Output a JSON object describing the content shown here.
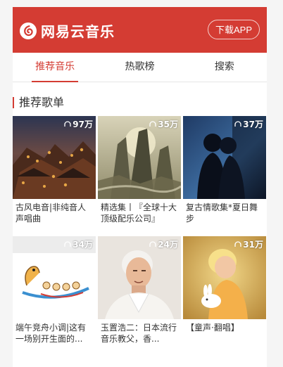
{
  "header": {
    "logo_text": "网易云音乐",
    "download_label": "下载APP",
    "brand_color": "#d43c33"
  },
  "tabs": [
    {
      "label": "推荐音乐",
      "active": true
    },
    {
      "label": "热歌榜",
      "active": false
    },
    {
      "label": "搜索",
      "active": false
    }
  ],
  "section": {
    "title": "推荐歌单"
  },
  "playlists": [
    {
      "count": "97万",
      "title": "古风电音|非纯音人声唱曲",
      "cover_icon": "ancient-town-night-image"
    },
    {
      "count": "35万",
      "title": "精选集丨『全球十大顶级配乐公司』",
      "cover_icon": "misty-mountains-image"
    },
    {
      "count": "37万",
      "title": "复古情歌集*夏日舞步",
      "cover_icon": "couple-silhouette-image"
    },
    {
      "count": "34万",
      "title": "端午竞舟小调|这有一场别开生面的...",
      "cover_icon": "dragon-boat-image"
    },
    {
      "count": "24万",
      "title": "玉置浩二：日本流行音乐教父，香...",
      "cover_icon": "portrait-man-image"
    },
    {
      "count": "31万",
      "title": "【童声·翻唱】",
      "cover_icon": "child-with-rabbit-image"
    }
  ]
}
